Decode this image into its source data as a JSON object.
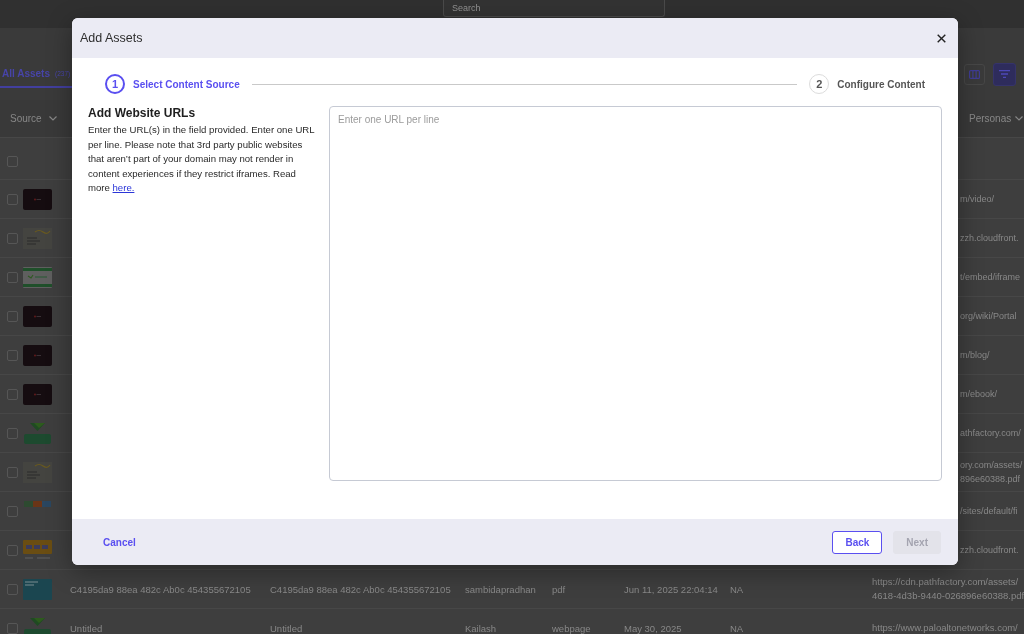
{
  "top_bar": {
    "search": {
      "placeholder": "Search"
    }
  },
  "tabs": [
    {
      "label": "All Assets",
      "count": "(237)",
      "selected": true
    }
  ],
  "toolbar": [
    {
      "kind": "columns",
      "on": false
    },
    {
      "kind": "filter",
      "on": true
    }
  ],
  "table": {
    "header": {
      "column_1": "Source",
      "column_9": "Personas"
    },
    "select_all": {
      "checked": false
    },
    "rows": [
      {
        "checked": false,
        "thumbnail": {
          "kind": "dark"
        },
        "column_8": [
          "m/video/"
        ]
      },
      {
        "checked": false,
        "thumbnail": {
          "kind": "document"
        },
        "column_8": [
          "zzh.cloudfront."
        ]
      },
      {
        "checked": false,
        "thumbnail": {
          "kind": "banner"
        },
        "column_8": [
          "t/embed/iframe"
        ]
      },
      {
        "checked": false,
        "thumbnail": {
          "kind": "dark"
        },
        "column_8": [
          "org/wiki/Portal"
        ]
      },
      {
        "checked": false,
        "thumbnail": {
          "kind": "dark"
        },
        "column_8": [
          "m/blog/"
        ]
      },
      {
        "checked": false,
        "thumbnail": {
          "kind": "dark"
        },
        "column_8": [
          "m/ebook/"
        ]
      },
      {
        "checked": false,
        "thumbnail": {
          "kind": "logo"
        },
        "column_8": [
          "athfactory.com/"
        ]
      },
      {
        "checked": false,
        "thumbnail": {
          "kind": "document"
        },
        "column_8": [
          "ory.com/assets/",
          "896e60388.pdf"
        ]
      },
      {
        "checked": false,
        "thumbnail": {
          "kind": "strip"
        },
        "column_8": [
          "/sites/default/fi"
        ]
      },
      {
        "checked": false,
        "thumbnail": {
          "kind": "card"
        },
        "column_8": [
          "zzh.cloudfront."
        ]
      },
      {
        "checked": false,
        "thumbnail": {
          "kind": "teal"
        },
        "column_2": "C4195da9 88ea 482c Ab0c 454355672105",
        "column_3": "C4195da9 88ea 482c Ab0c 454355672105",
        "column_4": "sambidapradhan",
        "column_5": "pdf",
        "column_6": "Jun 11, 2025 22:04:14",
        "column_7": "NA",
        "column_8": [
          "https://cdn.pathfactory.com/assets/",
          "4618-4d3b-9440-026896e60388.pdf"
        ]
      },
      {
        "checked": false,
        "thumbnail": {
          "kind": "logo"
        },
        "column_2": "Untitled",
        "column_3": "Untitled",
        "column_4": "Kailash",
        "column_5": "webpage",
        "column_6": "May 30, 2025",
        "column_7": "NA",
        "column_8": [
          "https://www.paloaltonetworks.com/"
        ]
      }
    ]
  },
  "modal": {
    "title": "Add Assets",
    "steps": [
      {
        "number": "1",
        "label": "Select Content Source",
        "active": true
      },
      {
        "number": "2",
        "label": "Configure Content",
        "active": false
      }
    ],
    "heading": "Add Website URLs",
    "description": "Enter the URL(s) in the field provided. Enter one URL per line. Please note that 3rd party public websites that aren’t part of your domain may not render in content experiences if they restrict iframes. Read more",
    "link": "here.",
    "url_field": {
      "placeholder": "Enter one URL per line"
    },
    "cancel": {
      "label": "Cancel"
    },
    "buttons": [
      {
        "label": "Back",
        "kind": "outline",
        "disabled": false
      },
      {
        "label": "Next",
        "kind": "primary",
        "disabled": true
      }
    ]
  }
}
